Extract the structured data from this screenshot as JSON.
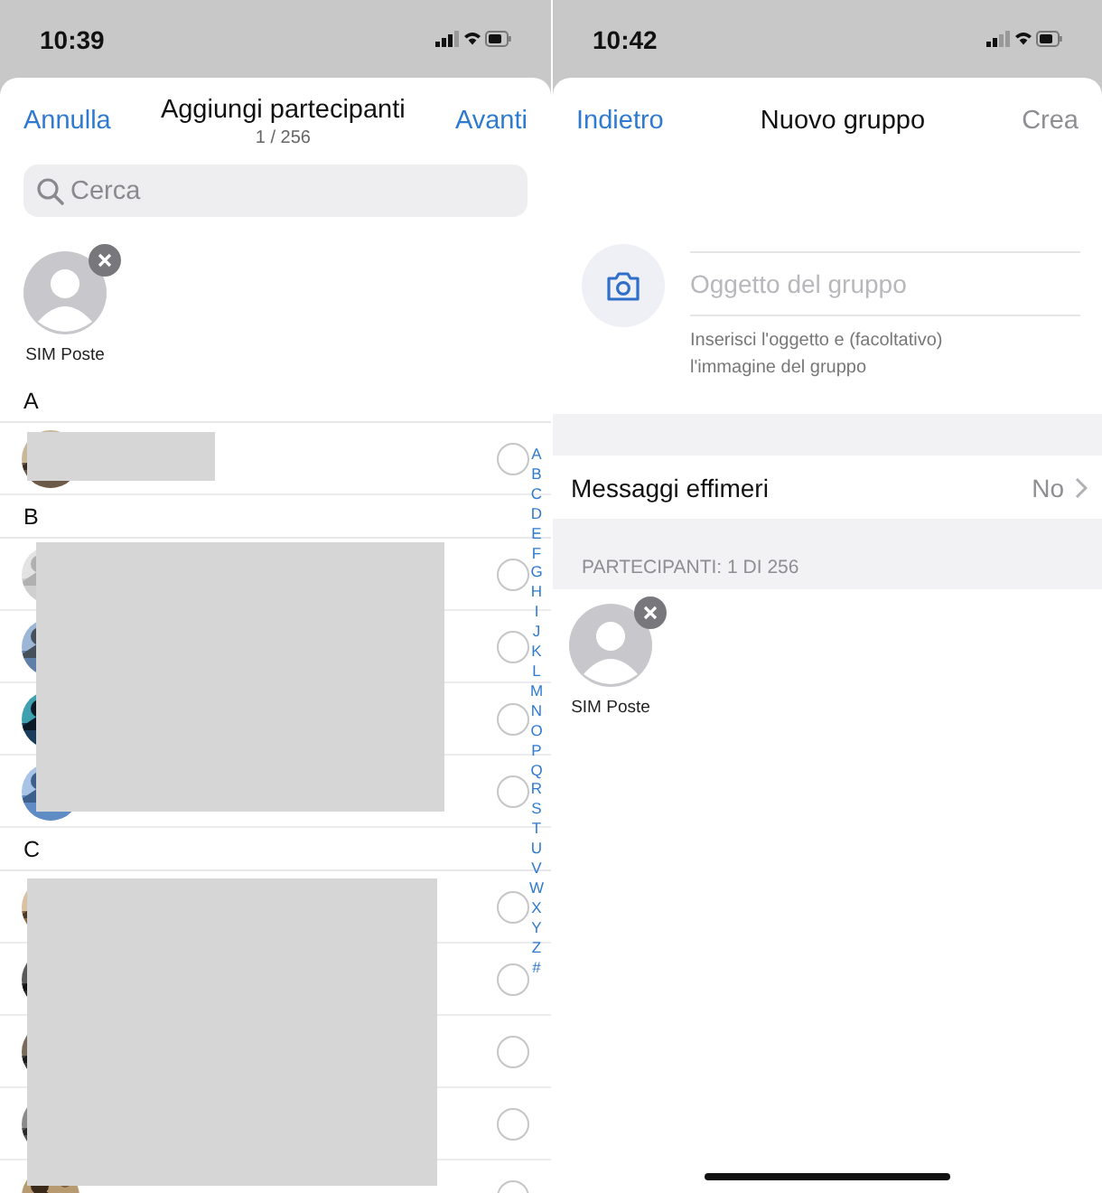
{
  "left": {
    "status_time": "10:39",
    "nav": {
      "cancel": "Annulla",
      "title": "Aggiungi partecipanti",
      "subtitle": "1 / 256",
      "next": "Avanti"
    },
    "search": {
      "placeholder": "Cerca"
    },
    "selected_contacts": [
      {
        "name": "SIM Poste"
      }
    ],
    "sections": [
      {
        "letter": "A",
        "rows": [
          {
            "selected": false
          }
        ]
      },
      {
        "letter": "B",
        "rows": [
          {
            "selected": false
          },
          {
            "selected": false
          },
          {
            "selected": false
          },
          {
            "selected": false
          }
        ]
      },
      {
        "letter": "C",
        "rows": [
          {
            "selected": false
          },
          {
            "selected": false
          },
          {
            "selected": false
          },
          {
            "selected": false
          },
          {
            "selected": false
          }
        ]
      }
    ],
    "index": [
      "A",
      "B",
      "C",
      "D",
      "E",
      "F",
      "G",
      "H",
      "I",
      "J",
      "K",
      "L",
      "M",
      "N",
      "O",
      "P",
      "Q",
      "R",
      "S",
      "T",
      "U",
      "V",
      "W",
      "X",
      "Y",
      "Z",
      "#"
    ]
  },
  "right": {
    "status_time": "10:42",
    "nav": {
      "back": "Indietro",
      "title": "Nuovo gruppo",
      "create": "Crea",
      "create_disabled": true
    },
    "subject": {
      "placeholder": "Oggetto del gruppo"
    },
    "hint": "Inserisci l'oggetto e (facoltativo) l'immagine del gruppo",
    "ephemeral": {
      "label": "Messaggi effimeri",
      "value": "No"
    },
    "participants_header": "PARTECIPANTI: 1 DI 256",
    "participants": [
      {
        "name": "SIM Poste"
      }
    ]
  }
}
